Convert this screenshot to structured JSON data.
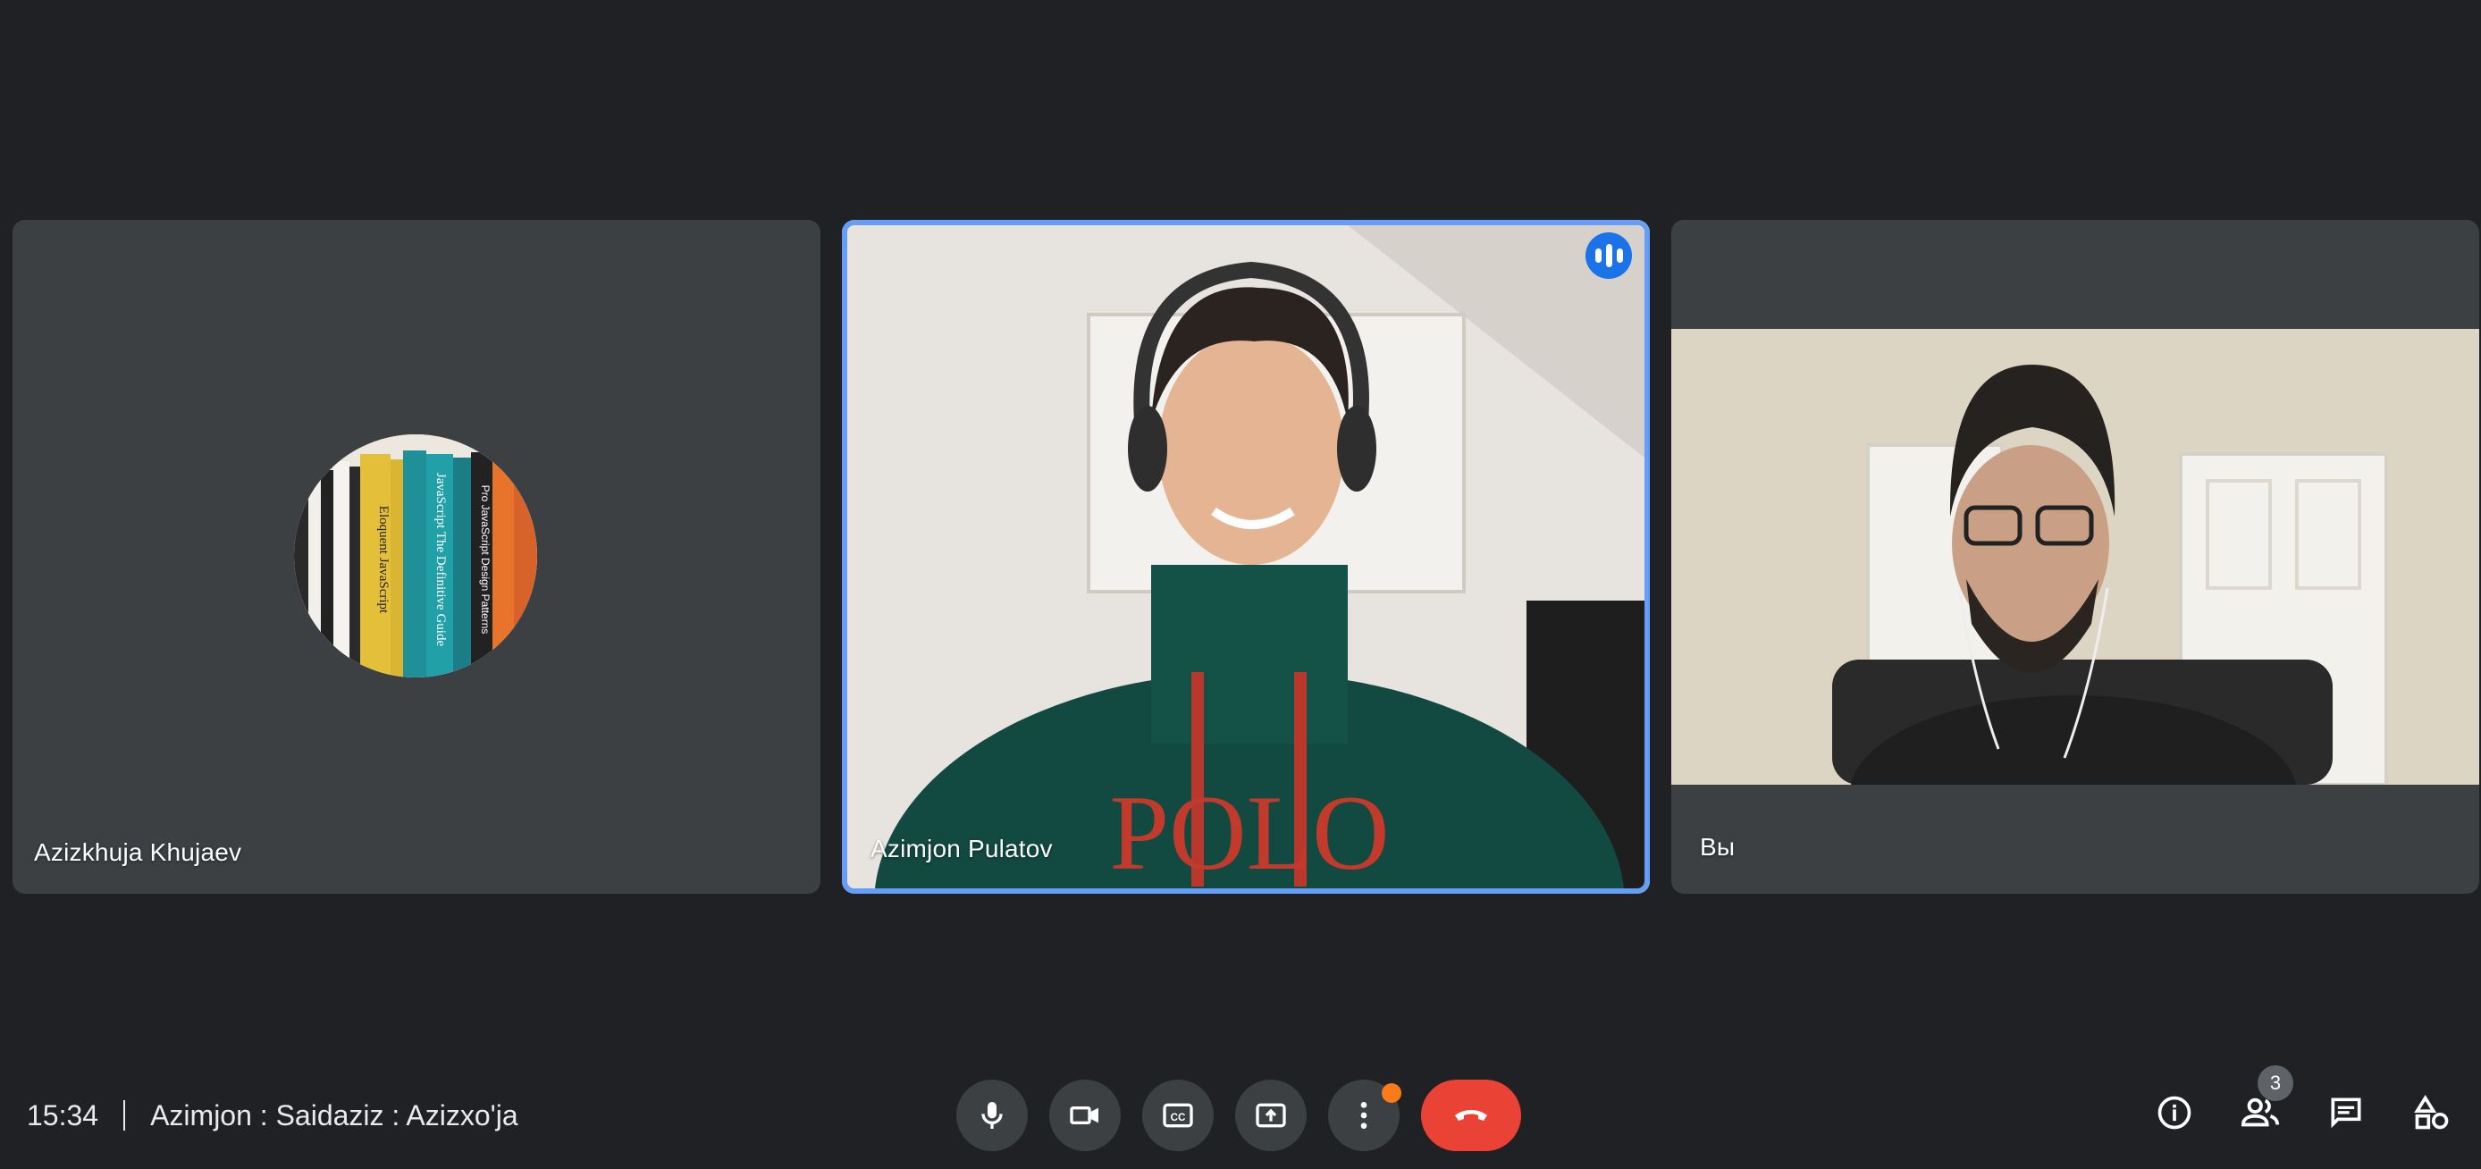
{
  "participants": [
    {
      "name": "Azizkhuja Khujaev",
      "avatar": "bookshelf-avatar"
    },
    {
      "name": "Azimjon Pulatov",
      "speaking": true
    },
    {
      "name": "Вы"
    }
  ],
  "meeting": {
    "time": "15:34",
    "title": "Azimjon : Saidaziz : Azizxo'ja"
  },
  "controls": {
    "icons": [
      "microphone-icon",
      "camera-icon",
      "captions-icon",
      "present-icon",
      "more-options-icon",
      "hang-up-icon"
    ]
  },
  "right_panel": {
    "icons": [
      "info-icon",
      "people-icon",
      "chat-icon",
      "activities-icon"
    ],
    "people_count": "3"
  },
  "colors": {
    "background": "#202124",
    "tile": "#3c4043",
    "active_speaker_border": "#669df6",
    "hangup": "#ea4335",
    "notification_dot": "#fa7b17"
  },
  "avatar_spine_text": [
    "Eloquent JavaScript",
    "JavaScript The Definitive Guide",
    "Pro JavaScript Design Patterns"
  ]
}
